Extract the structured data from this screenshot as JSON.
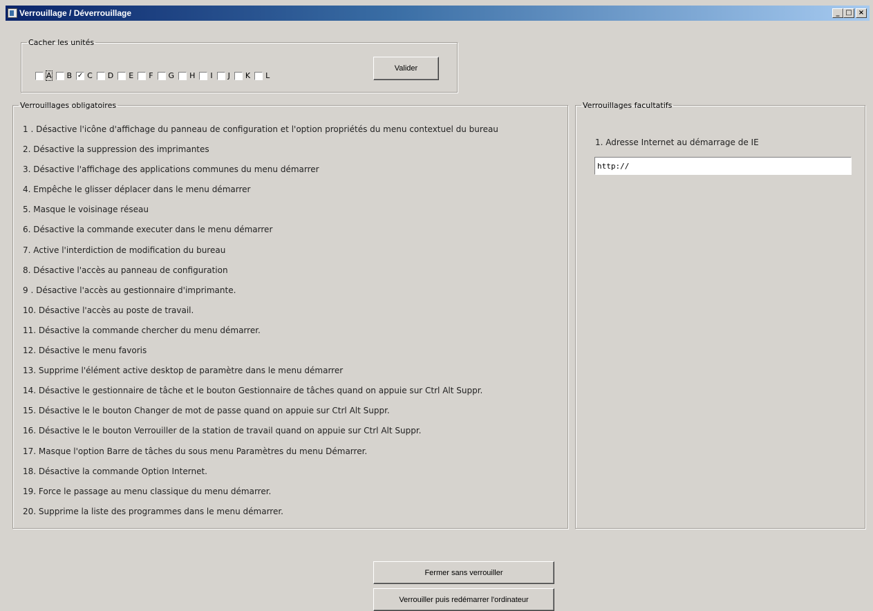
{
  "window": {
    "title": "Verrouillage / Déverrouillage",
    "minimize": "_",
    "maximize": "□",
    "close": "×"
  },
  "units_group": {
    "legend": "Cacher les unités",
    "units": [
      {
        "label": "A",
        "checked": false
      },
      {
        "label": "B",
        "checked": false
      },
      {
        "label": "C",
        "checked": true
      },
      {
        "label": "D",
        "checked": false
      },
      {
        "label": "E",
        "checked": false
      },
      {
        "label": "F",
        "checked": false
      },
      {
        "label": "G",
        "checked": false
      },
      {
        "label": "H",
        "checked": false
      },
      {
        "label": "I",
        "checked": false
      },
      {
        "label": "J",
        "checked": false
      },
      {
        "label": "K",
        "checked": false
      },
      {
        "label": "L",
        "checked": false
      }
    ],
    "validate_label": "Valider"
  },
  "mandatory": {
    "legend": "Verrouillages obligatoires",
    "items": [
      "1 . Désactive l'icône d'affichage du panneau de configuration  et l'option propriétés du menu contextuel du bureau",
      "2. Désactive la suppression des imprimantes",
      "3. Désactive l'affichage des applications communes du menu démarrer",
      "4. Empêche le glisser déplacer dans le menu démarrer",
      "5. Masque le voisinage réseau",
      "6. Désactive la commande executer dans le menu démarrer",
      "7. Active l'interdiction de modification du bureau",
      "8. Désactive l'accès au panneau de configuration",
      "9 . Désactive l'accès au gestionnaire d'imprimante.",
      "10. Désactive l'accès au poste de travail.",
      "11. Désactive la commande chercher du menu démarrer.",
      "12. Désactive le menu favoris",
      "13. Supprime l'élément active desktop de paramètre dans le menu démarrer",
      "14. Désactive le gestionnaire de tâche et le bouton Gestionnaire de tâches quand on appuie sur Ctrl Alt Suppr.",
      "15. Désactive le le bouton Changer de mot de passe quand on appuie sur Ctrl Alt Suppr.",
      "16. Désactive le le bouton Verrouiller de la station de travail quand on appuie sur Ctrl Alt Suppr.",
      "17. Masque l'option Barre de tâches du sous menu Paramètres du menu Démarrer.",
      "18. Désactive la commande Option Internet.",
      "19. Force le passage au menu classique du menu démarrer.",
      "20. Supprime la liste des programmes dans le menu démarrer."
    ]
  },
  "optional": {
    "legend": "Verrouillages facultatifs",
    "item_label": "1. Adresse Internet au démarrage de IE",
    "url_value": "http://"
  },
  "buttons": {
    "close_without_lock": "Fermer sans verrouiller",
    "lock_and_restart": "Verrouiller puis redémarrer l'ordinateur"
  }
}
